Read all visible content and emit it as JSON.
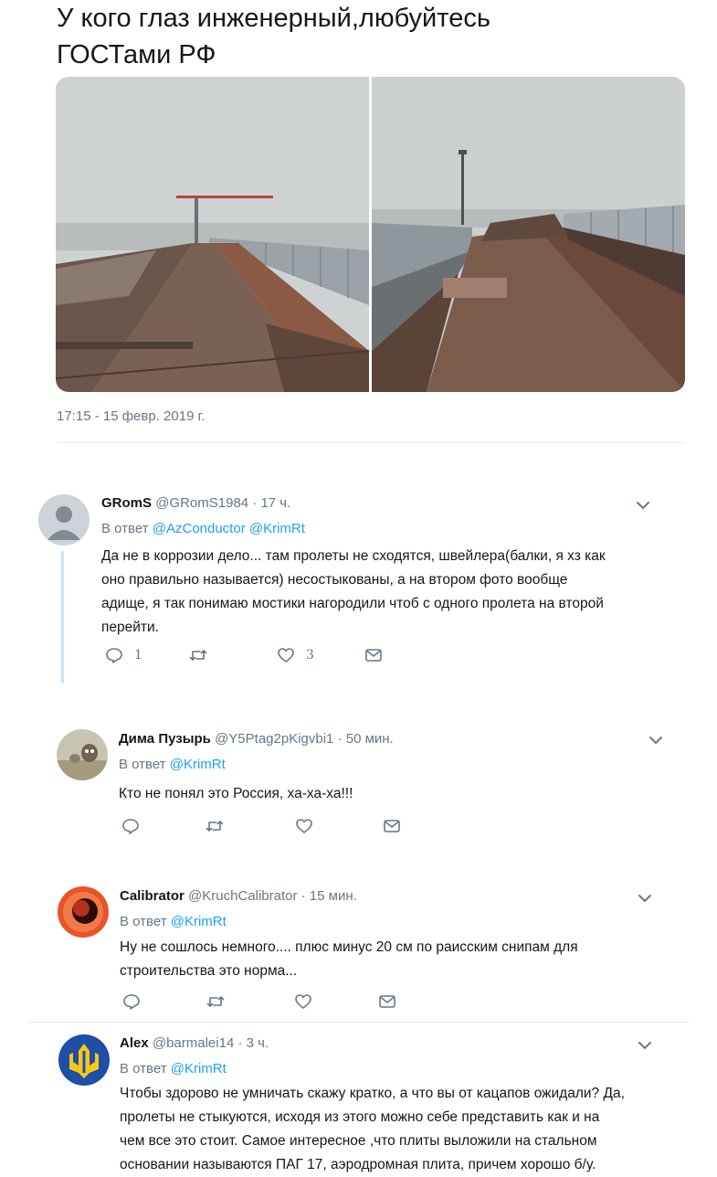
{
  "tweet": {
    "text_line1": "У кого глаз инженерный,любуйтесь",
    "text_line2": "ГОСТами РФ",
    "timestamp": "17:15 - 15 февр. 2019 г."
  },
  "replies": [
    {
      "name": "GRomS",
      "handle": "@GRomS1984 · 17 ч.",
      "reply_prefix": "В ответ",
      "mentions": [
        "@AzConductor",
        "@KrimRt"
      ],
      "lines": [
        "Да не в коррозии дело... там пролеты не сходятся, швейлера(балки, я хз как",
        "оно правильно называется) несостыкованы, а на втором фото вообще",
        "адище, я так понимаю мостики нагородили чтоб с одного пролета на второй",
        "перейти."
      ],
      "reply_count": "1",
      "retweet_count": "",
      "like_count": "3"
    },
    {
      "name": "Дима Пузырь",
      "handle": "@Y5Ptag2pKigvbi1 · 50 мин.",
      "reply_prefix": "В ответ",
      "mentions": [
        "@KrimRt"
      ],
      "lines": [
        "Кто не понял это Россия, ха-ха-ха!!!"
      ],
      "reply_count": "",
      "retweet_count": "",
      "like_count": ""
    },
    {
      "name": "Calibrator",
      "handle": "@KruchCalibrator · 15 мин.",
      "reply_prefix": "В ответ",
      "mentions": [
        "@KrimRt"
      ],
      "lines": [
        "Ну не сошлось немного.... плюс минус 20 см по раисским снипам для",
        "строительства это норма..."
      ],
      "reply_count": "",
      "retweet_count": "",
      "like_count": ""
    },
    {
      "name": "Alex",
      "handle": "@barmalei14 · 3 ч.",
      "reply_prefix": "В ответ",
      "mentions": [
        "@KrimRt"
      ],
      "lines": [
        "Чтобы здорово не умничать скажу кратко, а что вы от кацапов ожидали? Да,",
        "пролеты не стыкуются,  исходя из этого можно себе представить как и на",
        "чем все это стоит. Самое интересное ,что плиты выложили на стальном",
        "основании называются ПАГ 17, аэродромная плита, причем  хорошо б/у."
      ]
    }
  ],
  "colors": {
    "link": "#1da1f2",
    "secondary_text": "#657786",
    "thread_line": "#c5e4f7",
    "divider": "#e6ecf0"
  },
  "icons": [
    "reply-icon",
    "retweet-icon",
    "like-icon",
    "dm-icon",
    "chevron-down-icon"
  ]
}
